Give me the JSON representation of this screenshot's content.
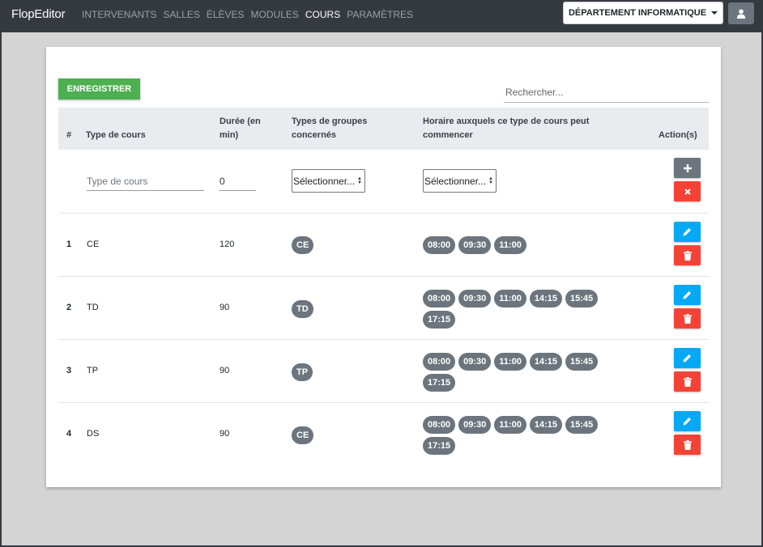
{
  "app": {
    "brand": "FlopEditor",
    "nav": [
      {
        "label": "INTERVENANTS",
        "active": false
      },
      {
        "label": "SALLES",
        "active": false
      },
      {
        "label": "ÉLÈVES",
        "active": false
      },
      {
        "label": "MODULES",
        "active": false
      },
      {
        "label": "COURS",
        "active": true
      },
      {
        "label": "PARAMÈTRES",
        "active": false
      }
    ],
    "department": "DÉPARTEMENT INFORMATIQUE"
  },
  "toolbar": {
    "save_label": "ENREGISTRER",
    "search_placeholder": "Rechercher..."
  },
  "table": {
    "headers": {
      "index": "#",
      "type": "Type de cours",
      "duration": "Durée (en min)",
      "groups": "Types de groupes concernés",
      "hours": "Horaire auxquels ce type de cours peut commencer",
      "actions": "Action(s)"
    },
    "new_row": {
      "type_placeholder": "Type de cours",
      "duration_value": "0",
      "groups_select": "Sélectionner...",
      "hours_select": "Sélectionner..."
    },
    "rows": [
      {
        "index": "1",
        "type": "CE",
        "duration": "120",
        "group": "CE",
        "hours": [
          "08:00",
          "09:30",
          "11:00"
        ]
      },
      {
        "index": "2",
        "type": "TD",
        "duration": "90",
        "group": "TD",
        "hours": [
          "08:00",
          "09:30",
          "11:00",
          "14:15",
          "15:45",
          "17:15"
        ]
      },
      {
        "index": "3",
        "type": "TP",
        "duration": "90",
        "group": "TP",
        "hours": [
          "08:00",
          "09:30",
          "11:00",
          "14:15",
          "15:45",
          "17:15"
        ]
      },
      {
        "index": "4",
        "type": "DS",
        "duration": "90",
        "group": "CE",
        "hours": [
          "08:00",
          "09:30",
          "11:00",
          "14:15",
          "15:45",
          "17:15"
        ]
      }
    ]
  },
  "colors": {
    "navbar": "#343a40",
    "save": "#4caf50",
    "edit": "#03a9f4",
    "delete": "#f44336",
    "pill": "#6c757d"
  },
  "icons": {
    "user": "user-icon",
    "add": "plus-icon",
    "cancel": "close-icon",
    "edit": "pencil-icon",
    "delete": "trash-icon"
  }
}
